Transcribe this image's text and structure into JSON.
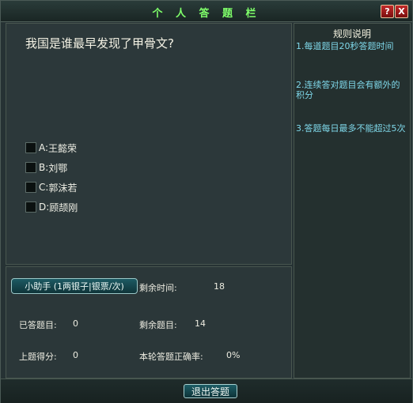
{
  "window": {
    "title": "个 人 答 题 栏",
    "help_button": "?",
    "close_button": "X"
  },
  "question": {
    "text": "我国是谁最早发现了甲骨文?",
    "options": [
      {
        "key": "A:",
        "label": "王懿荣"
      },
      {
        "key": "B:",
        "label": "刘鄂"
      },
      {
        "key": "C:",
        "label": "郭沫若"
      },
      {
        "key": "D:",
        "label": "顾颉刚"
      }
    ]
  },
  "rules": {
    "title": "规则说明",
    "items": [
      "1.每道题目20秒答题时间",
      "2.连续答对题目会有额外的积分",
      "3.答题每日最多不能超过5次"
    ]
  },
  "stats": {
    "helper_button": "小助手 (1两银子|银票/次)",
    "time_left_label": "剩余时间:",
    "time_left_value": "18",
    "answered_label": "已答题目:",
    "answered_value": "0",
    "remaining_label": "剩余题目:",
    "remaining_value": "14",
    "last_score_label": "上题得分:",
    "last_score_value": "0",
    "accuracy_label": "本轮答题正确率:",
    "accuracy_value": "0%"
  },
  "footer": {
    "exit_button": "退出答题"
  },
  "colors": {
    "title_text": "#7fff6a",
    "rule_text": "#7fd8ea",
    "button_fill": "#1d5a63",
    "close_button": "#c22a2a"
  }
}
